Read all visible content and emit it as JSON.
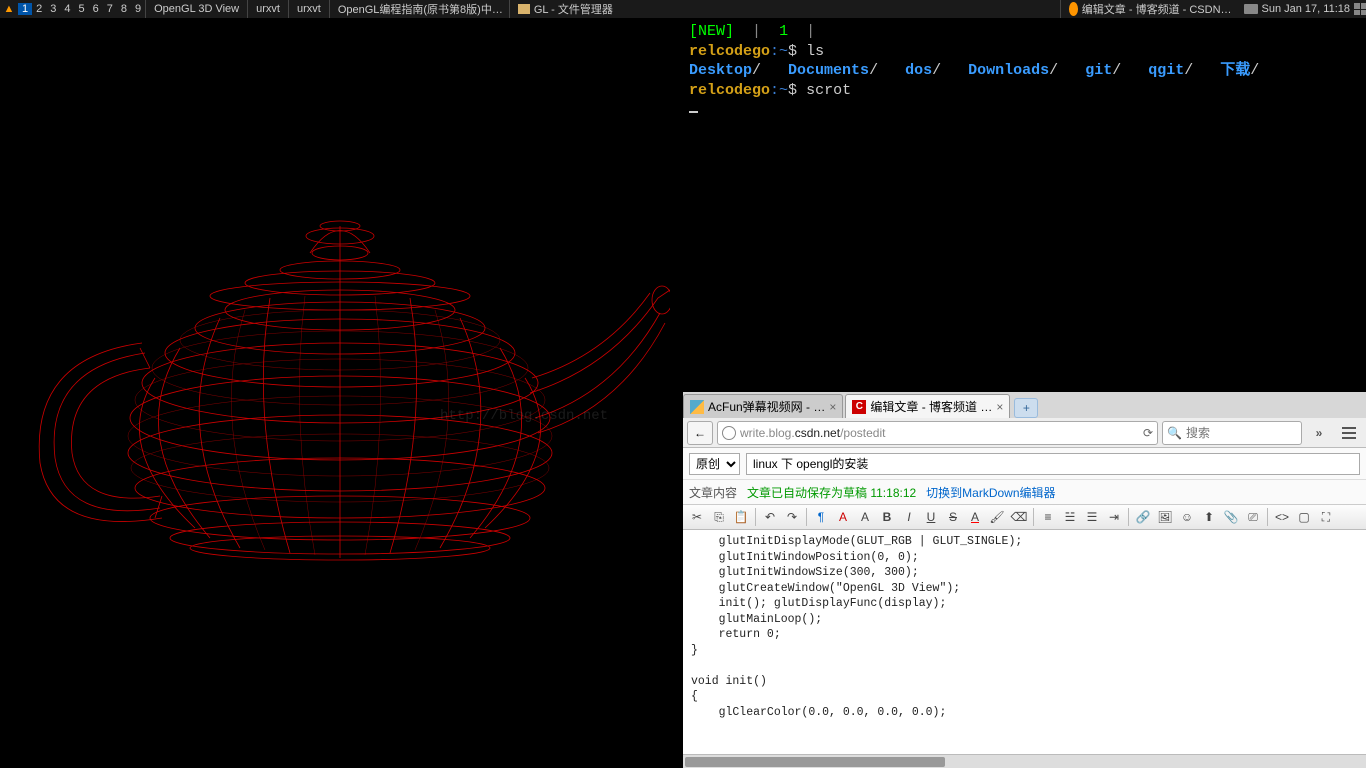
{
  "taskbar": {
    "workspaces": [
      "1",
      "2",
      "3",
      "4",
      "5",
      "6",
      "7",
      "8",
      "9"
    ],
    "active_ws": 0,
    "buttons": [
      {
        "label": "OpenGL 3D View"
      },
      {
        "label": "urxvt"
      },
      {
        "label": "urxvt"
      },
      {
        "label": "OpenGL编程指南(原书第8版)中…"
      },
      {
        "label": "GL - 文件管理器"
      },
      {
        "label": "编辑文章 - 博客频道 - CSDN…"
      }
    ],
    "clock": "Sun Jan 17, 11:18"
  },
  "watermark": "http://blog.csdn.net",
  "terminal": {
    "status_new": "[NEW]",
    "status_sep": "|",
    "status_num": "1",
    "status_sep2": "|",
    "user": "relcodego",
    "host_path": ":~",
    "prompt": "$",
    "cmd1": "ls",
    "dirs": [
      "Desktop",
      "Documents",
      "dos",
      "Downloads",
      "git",
      "qgit",
      "下载"
    ],
    "cmd2": "scrot"
  },
  "browser": {
    "tabs": [
      {
        "title": "AcFun弹幕视频网 - …",
        "active": false
      },
      {
        "title": "编辑文章 - 博客频道 …",
        "active": true
      }
    ],
    "url_grey1": "write.blog.",
    "url_dark": "csdn.net",
    "url_grey2": "/postedit",
    "search_placeholder": "搜索",
    "dd_label": "原创",
    "title_value": "linux 下 opengl的安装",
    "sub_label": "文章内容",
    "sub_save": "文章已自动保存为草稿 11:18:12",
    "sub_link": "切换到MarkDown编辑器",
    "code_lines": [
      "    glutInitDisplayMode(GLUT_RGB | GLUT_SINGLE);",
      "    glutInitWindowPosition(0, 0);",
      "    glutInitWindowSize(300, 300);",
      "    glutCreateWindow(\"OpenGL 3D View\");",
      "    init(); glutDisplayFunc(display);",
      "    glutMainLoop();",
      "    return 0;",
      "}",
      "",
      "void init()",
      "{",
      "    glClearColor(0.0, 0.0, 0.0, 0.0);"
    ]
  }
}
